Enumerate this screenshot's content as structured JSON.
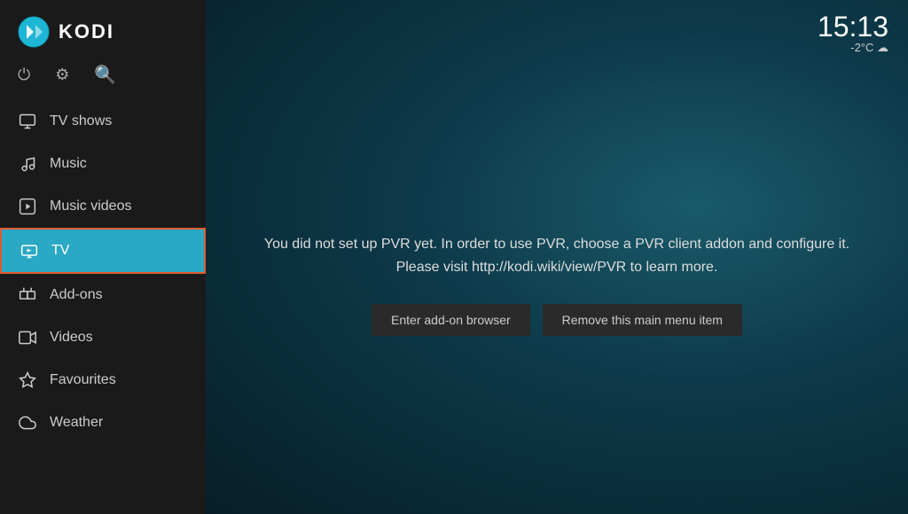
{
  "logo": {
    "title": "KODI"
  },
  "toolbar": {
    "power_icon": "⏻",
    "settings_icon": "⚙",
    "search_icon": "🔍"
  },
  "nav": {
    "items": [
      {
        "id": "tv-shows",
        "label": "TV shows",
        "icon": "tv",
        "active": false
      },
      {
        "id": "music",
        "label": "Music",
        "icon": "music",
        "active": false
      },
      {
        "id": "music-videos",
        "label": "Music videos",
        "icon": "music-video",
        "active": false
      },
      {
        "id": "tv",
        "label": "TV",
        "icon": "tv-box",
        "active": true
      },
      {
        "id": "add-ons",
        "label": "Add-ons",
        "icon": "addon",
        "active": false
      },
      {
        "id": "videos",
        "label": "Videos",
        "icon": "video",
        "active": false
      },
      {
        "id": "favourites",
        "label": "Favourites",
        "icon": "star",
        "active": false
      },
      {
        "id": "weather",
        "label": "Weather",
        "icon": "weather",
        "active": false
      }
    ]
  },
  "clock": {
    "time": "15:13",
    "weather": "-2°C ☁"
  },
  "pvr": {
    "message_line1": "You did not set up PVR yet. In order to use PVR, choose a PVR client addon and configure it.",
    "message_line2": "Please visit http://kodi.wiki/view/PVR to learn more.",
    "btn_addon_browser": "Enter add-on browser",
    "btn_remove": "Remove this main menu item"
  }
}
